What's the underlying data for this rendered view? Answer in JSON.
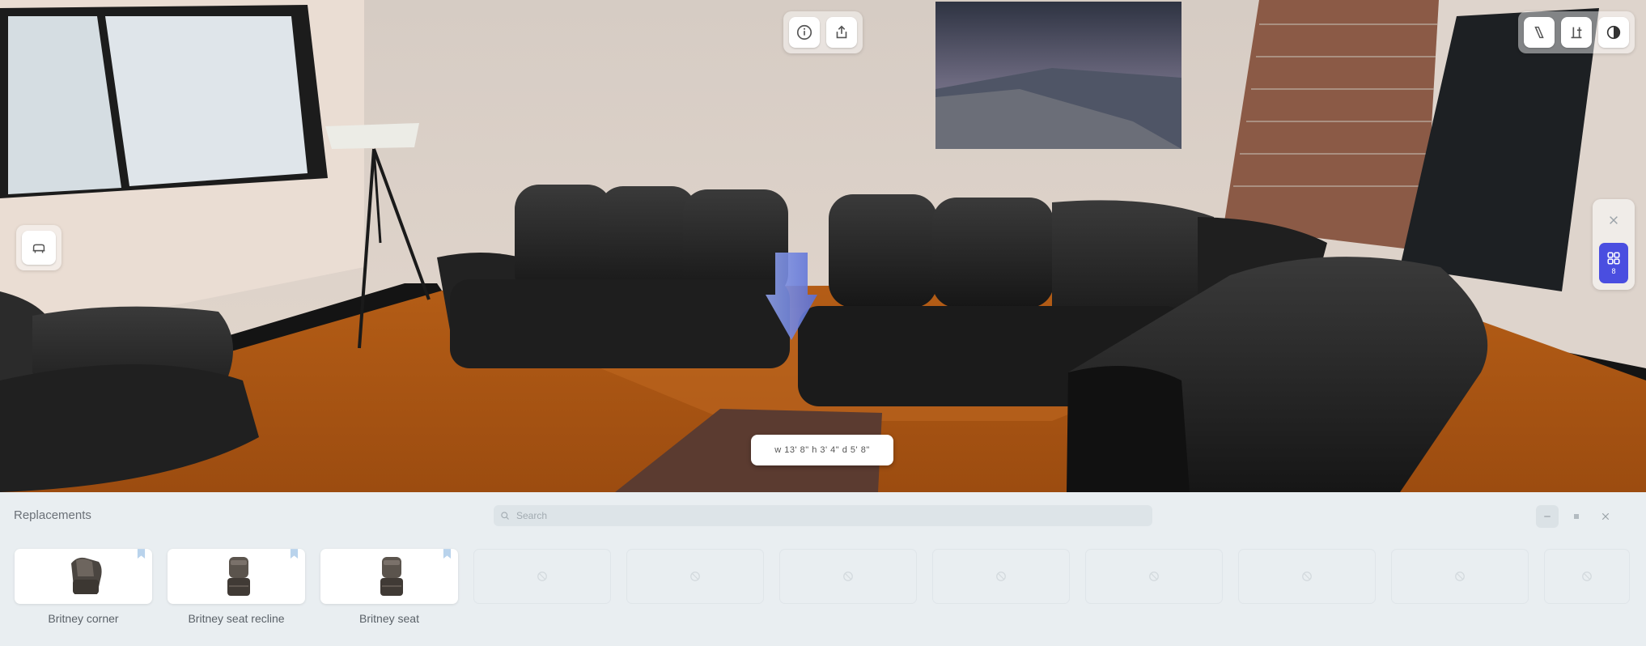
{
  "viewport": {
    "top_toolbar": {
      "info_icon": "info-icon",
      "share_icon": "share-icon"
    },
    "right_toolbar": {
      "icons": [
        "measure-icon",
        "layout-icon",
        "theme-icon"
      ]
    },
    "left_tool": {
      "icon": "car-seat-icon"
    },
    "side_panel": {
      "grid_count": "8"
    },
    "dimensions": "w 13' 8\"  h 3' 4\"  d 5' 8\""
  },
  "replacements": {
    "title": "Replacements",
    "search_placeholder": "Search",
    "items": [
      {
        "label": "Britney corner"
      },
      {
        "label": "Britney seat recline"
      },
      {
        "label": "Britney seat"
      }
    ],
    "empty_slots": 8
  },
  "colors": {
    "accent": "#4a4ee0",
    "panel_bg": "#e9eef1"
  }
}
